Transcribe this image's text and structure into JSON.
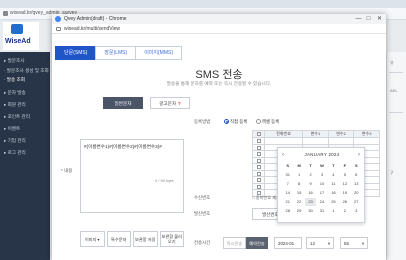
{
  "background": {
    "address": "wisead.kr/qvey_admin_survey",
    "logo_text": "WiseAd",
    "sidebar": [
      {
        "label": "▸ 발문조사",
        "active": false
      },
      {
        "label": "· 발문조사 생성 및 조회",
        "active": false
      },
      {
        "label": "· 발송 조회",
        "active": true
      },
      {
        "label": "▸ 문자 발송",
        "active": false
      },
      {
        "label": "▸ 회원 관리",
        "active": false
      },
      {
        "label": "▸ 포인트 관리",
        "active": false
      },
      {
        "label": "▸ 이벤트",
        "active": false
      },
      {
        "label": "▸ 기업 관리",
        "active": false
      },
      {
        "label": "▸ 로그 관리",
        "active": false
      }
    ],
    "right_labels": [
      "유",
      "AEL",
      "구"
    ]
  },
  "window": {
    "title": "Qvey Admin(draft) - Chrome",
    "url": "wisead.kr/multi/sendView",
    "buttons": [
      "—",
      "□",
      "✕"
    ]
  },
  "tabs": [
    "단문(SMS)",
    "장문(LMS)",
    "이미지(MMS)"
  ],
  "active_tab": 0,
  "page": {
    "title": "SMS 전송",
    "subtitle": "발송을 통해 문자를 예약 또는 즉시 전송할 수 있습니다."
  },
  "message": {
    "tabs": [
      "일반문자",
      "광고문자"
    ],
    "ad_mark": "?",
    "content_label": "* 내용",
    "text": "#{이름변수1}#{이름변수2}#{이름변수3}#",
    "bytes": "0 / 90 byte",
    "buttons": [
      "이미지 ▾",
      "특수문자",
      "보관함 저장",
      "보관함 불러오기"
    ]
  },
  "recipients": {
    "label": "등록방법",
    "options": [
      "직접 등록",
      "엑셀 등록"
    ],
    "selected": 0,
    "columns": [
      "",
      "전화번호",
      "변수1",
      "변수2",
      "변수3"
    ],
    "rows": 9
  },
  "calendar": {
    "month": "JANUARY 2024",
    "prev": "‹",
    "next": "›",
    "weekdays": [
      "S",
      "M",
      "T",
      "W",
      "T",
      "F",
      "S"
    ],
    "days": [
      "31",
      "1",
      "2",
      "3",
      "4",
      "5",
      "6",
      "7",
      "8",
      "9",
      "10",
      "11",
      "12",
      "13",
      "14",
      "15",
      "16",
      "17",
      "18",
      "19",
      "20",
      "21",
      "22",
      "23",
      "24",
      "25",
      "26",
      "27",
      "28",
      "29",
      "30",
      "31",
      "1",
      "2",
      "3"
    ],
    "selected_day": "23"
  },
  "send": {
    "sender_label": "수신번호",
    "sender_option": "□ 중복번호 제거",
    "number_label": "발신번호",
    "number_button": "발신번호 설정",
    "time_label": "전송시간",
    "time_options": [
      "즉시전송",
      "예약전송"
    ],
    "time_selected": 1,
    "date": "2024-01",
    "hour": "12",
    "minute": "55"
  }
}
